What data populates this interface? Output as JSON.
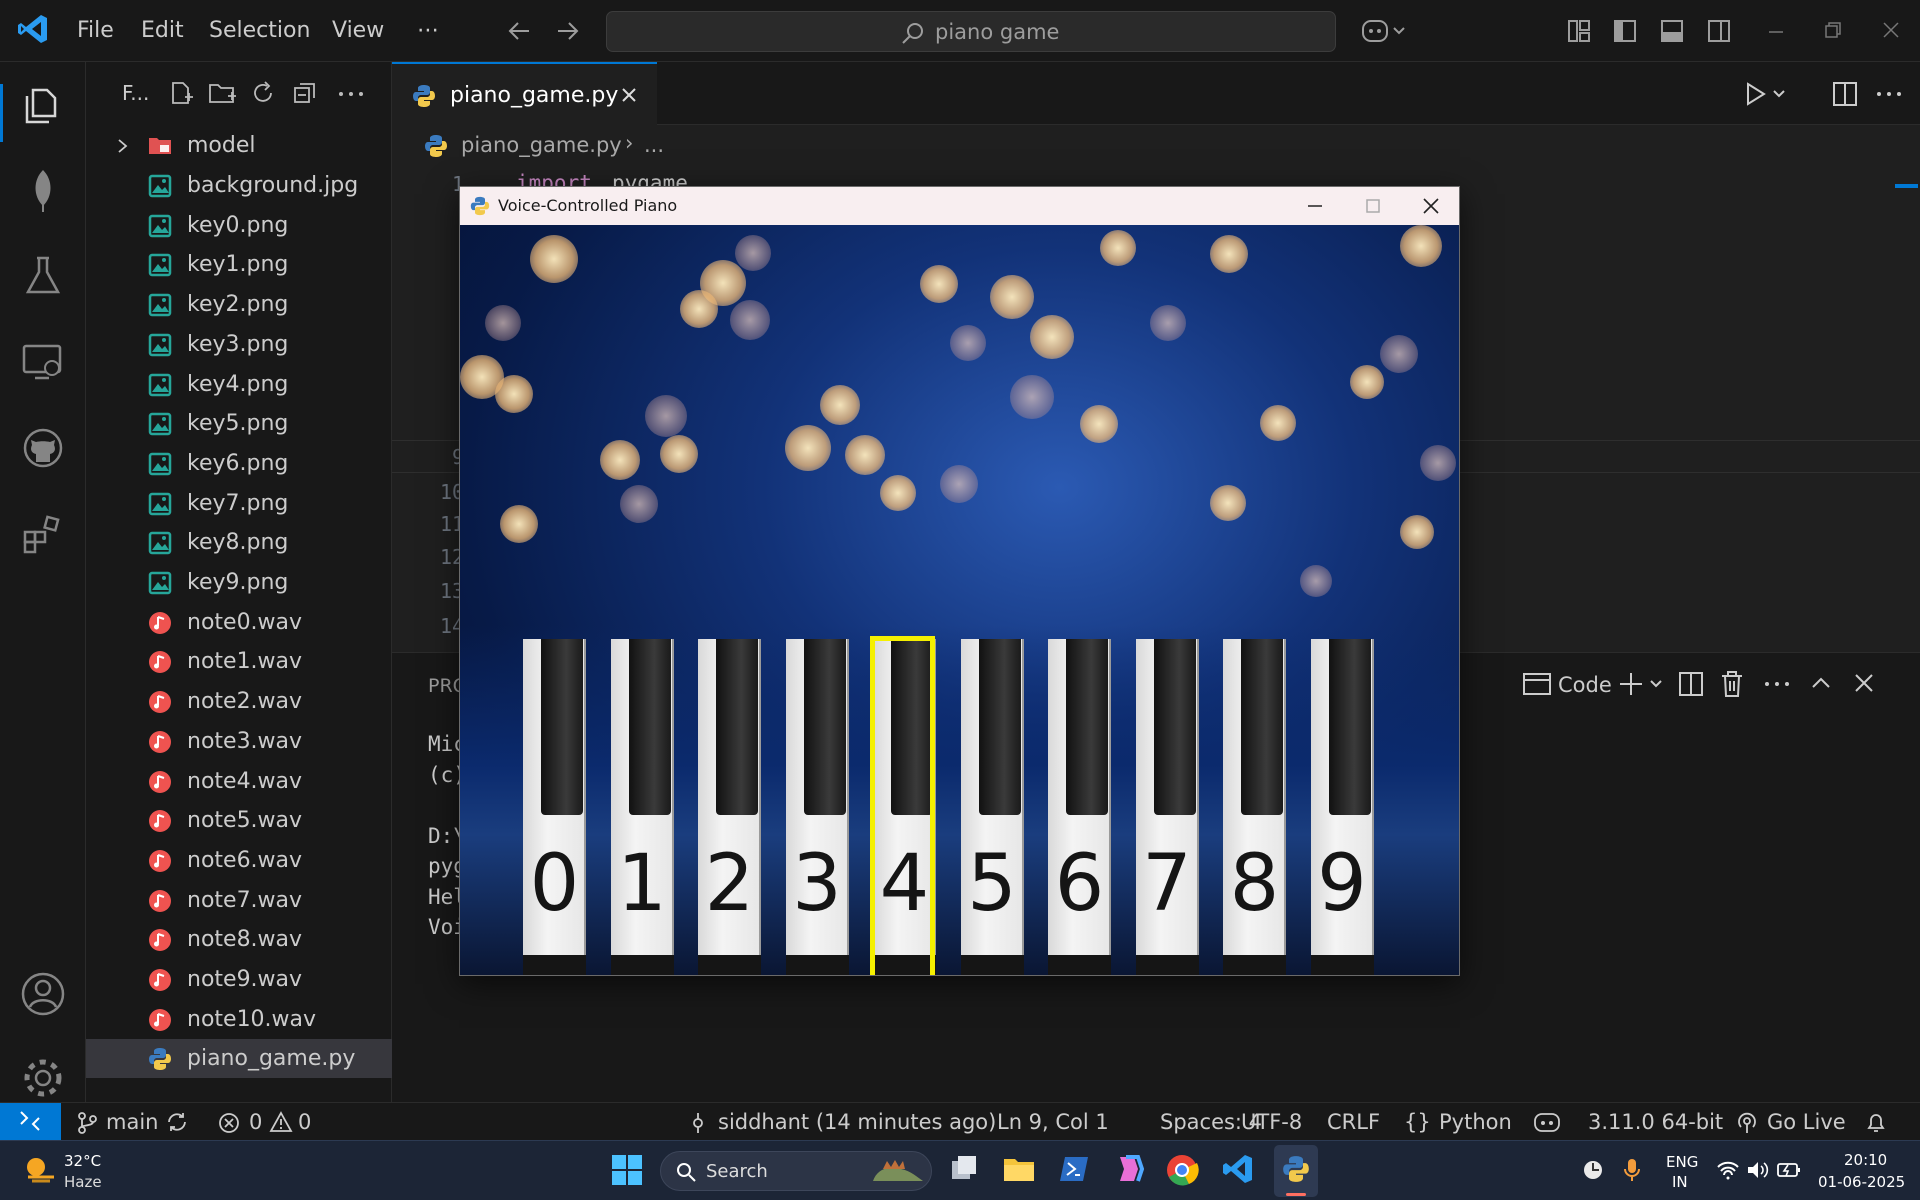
{
  "menu": [
    "File",
    "Edit",
    "Selection",
    "View",
    "⋯"
  ],
  "search": {
    "text": "piano game"
  },
  "explorer": {
    "title": "F...",
    "folder": "model",
    "files": [
      {
        "name": "background.jpg",
        "icon": "image"
      },
      {
        "name": "key0.png",
        "icon": "image"
      },
      {
        "name": "key1.png",
        "icon": "image"
      },
      {
        "name": "key2.png",
        "icon": "image"
      },
      {
        "name": "key3.png",
        "icon": "image"
      },
      {
        "name": "key4.png",
        "icon": "image"
      },
      {
        "name": "key5.png",
        "icon": "image"
      },
      {
        "name": "key6.png",
        "icon": "image"
      },
      {
        "name": "key7.png",
        "icon": "image"
      },
      {
        "name": "key8.png",
        "icon": "image"
      },
      {
        "name": "key9.png",
        "icon": "image"
      },
      {
        "name": "note0.wav",
        "icon": "audio"
      },
      {
        "name": "note1.wav",
        "icon": "audio"
      },
      {
        "name": "note2.wav",
        "icon": "audio"
      },
      {
        "name": "note3.wav",
        "icon": "audio"
      },
      {
        "name": "note4.wav",
        "icon": "audio"
      },
      {
        "name": "note5.wav",
        "icon": "audio"
      },
      {
        "name": "note6.wav",
        "icon": "audio"
      },
      {
        "name": "note7.wav",
        "icon": "audio"
      },
      {
        "name": "note8.wav",
        "icon": "audio"
      },
      {
        "name": "note9.wav",
        "icon": "audio"
      },
      {
        "name": "note10.wav",
        "icon": "audio"
      },
      {
        "name": "piano_game.py",
        "icon": "python",
        "selected": true
      }
    ]
  },
  "editor": {
    "tab": "piano_game.py",
    "breadcrumb_file": "piano_game.py",
    "breadcrumb_rest": "...",
    "code_line1_keyword": "import",
    "code_line1_rest": "pygame",
    "line_numbers": [
      "1",
      "",
      "",
      "",
      "",
      "",
      "",
      "",
      "9",
      "10",
      "11",
      "12",
      "13",
      "14"
    ]
  },
  "panel": {
    "tab": "PRO",
    "code_label": "Code",
    "terminal_lines": [
      "Mic",
      "(c)",
      "",
      "D:\\",
      "pyg",
      "Hel",
      "Voi"
    ]
  },
  "pygame": {
    "title": "Voice-Controlled Piano",
    "keys": [
      "0",
      "1",
      "2",
      "3",
      "4",
      "5",
      "6",
      "7",
      "8",
      "9"
    ],
    "highlighted_key": "4",
    "highlight_color": "#f5f000"
  },
  "statusbar": {
    "branch": "main",
    "errors": "0",
    "warnings": "0",
    "blame": "siddhant (14 minutes ago)",
    "position": "Ln 9, Col 1",
    "spaces": "Spaces: 4",
    "encoding": "UTF-8",
    "eol": "CRLF",
    "language": "Python",
    "interpreter": "3.11.0 64-bit",
    "golive": "Go Live"
  },
  "taskbar": {
    "temp": "32°C",
    "weather": "Haze",
    "search": "Search",
    "lang1": "ENG",
    "lang2": "IN",
    "time": "20:10",
    "date": "01-06-2025"
  },
  "colors": {
    "accent": "#0078d4",
    "python_keyword": "#c586c0"
  }
}
